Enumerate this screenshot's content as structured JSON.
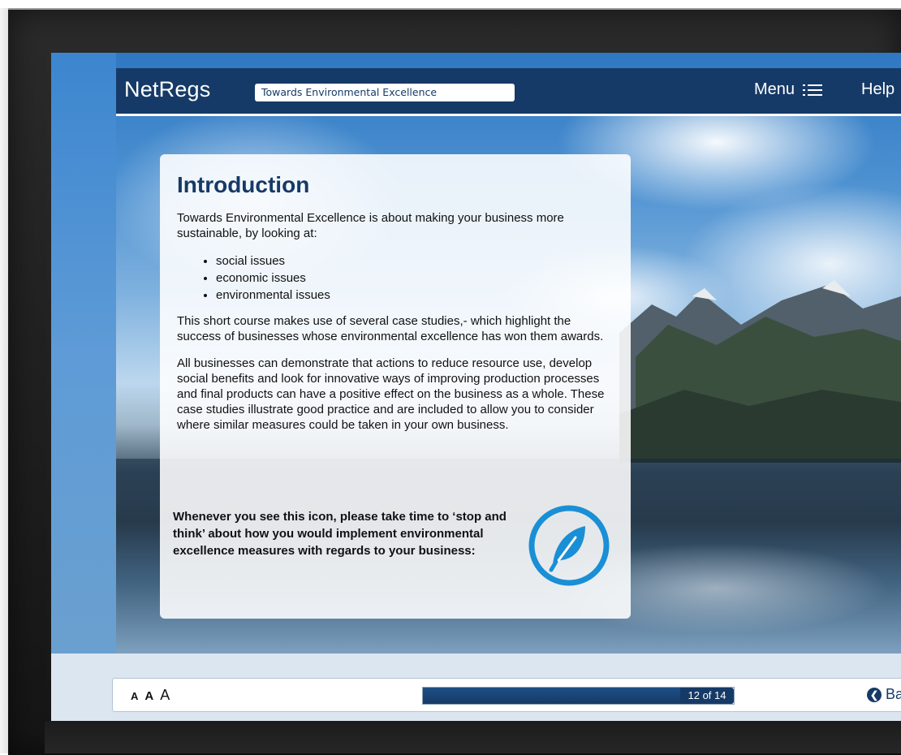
{
  "header": {
    "brand": "NetRegs",
    "course_title": "Towards Environmental Excellence",
    "menu_label": "Menu",
    "help_label": "Help"
  },
  "content": {
    "heading": "Introduction",
    "intro": "Towards Environmental Excellence is about making your business more sustainable, by looking at:",
    "issues": [
      "social issues",
      "economic issues",
      "environmental issues"
    ],
    "paragraph_case_studies": "This short course makes use of several case studies,- which highlight the success of businesses whose environmental excellence has won them awards.",
    "paragraph_businesses": "All businesses can demonstrate that actions to reduce resource use, develop social benefits and look for innovative ways of improving production processes and final products can have a positive effect on the business as a whole. These case studies illustrate good practice and are included to allow you to consider where similar measures could be taken in your own business.",
    "stop_and_think": "Whenever you see this icon, please take time to ‘stop and think’ about how you would implement environmental excellence measures with regards to your business:",
    "icon": "leaf-icon"
  },
  "toolbar": {
    "font_size_small": "A",
    "font_size_medium": "A",
    "font_size_large": "A",
    "progress_fraction": 0.857,
    "page_indicator": "12 of 14",
    "back_label": "Ba"
  },
  "colors": {
    "brand_navy": "#163a67",
    "accent_blue": "#1a8fd6"
  }
}
